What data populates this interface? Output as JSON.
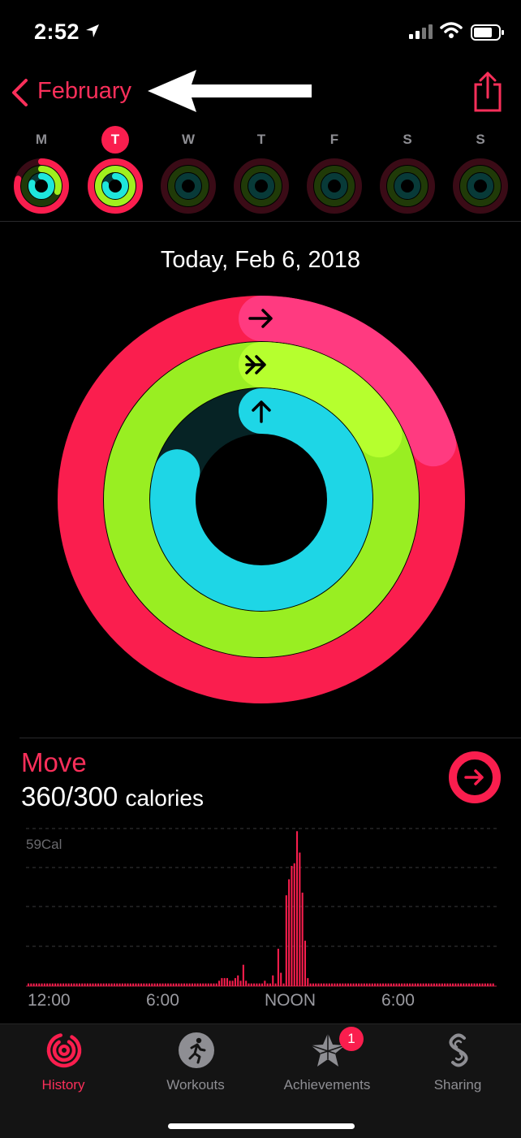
{
  "status_bar": {
    "time": "2:52"
  },
  "nav": {
    "back_label": "February"
  },
  "week": {
    "days": [
      "M",
      "T",
      "W",
      "T",
      "F",
      "S",
      "S"
    ],
    "today_index": 1
  },
  "summary": {
    "date": "Today, Feb 6, 2018"
  },
  "rings": {
    "move_progress": 1.2,
    "exercise_progress": 1.17,
    "stand_progress": 0.8
  },
  "move": {
    "title": "Move",
    "value": "360/300",
    "unit": "calories"
  },
  "chart_data": {
    "type": "bar",
    "y_label_max": "59Cal",
    "ylim": [
      0,
      59
    ],
    "x_ticks": [
      "12:00",
      "6:00",
      "NOON",
      "6:00"
    ],
    "values": [
      1,
      1,
      1,
      1,
      1,
      1,
      1,
      1,
      1,
      1,
      1,
      1,
      1,
      1,
      1,
      1,
      1,
      1,
      1,
      1,
      1,
      1,
      1,
      1,
      1,
      1,
      1,
      1,
      1,
      1,
      1,
      1,
      1,
      1,
      1,
      1,
      1,
      1,
      1,
      1,
      1,
      1,
      1,
      1,
      1,
      1,
      1,
      1,
      1,
      1,
      1,
      1,
      1,
      1,
      1,
      1,
      1,
      1,
      1,
      1,
      1,
      1,
      1,
      1,
      1,
      1,
      1,
      1,
      1,
      1,
      1,
      2,
      3,
      3,
      3,
      2,
      2,
      3,
      4,
      2,
      8,
      2,
      1,
      1,
      1,
      1,
      1,
      1,
      2,
      1,
      1,
      4,
      1,
      14,
      5,
      1,
      34,
      40,
      45,
      46,
      58,
      50,
      35,
      17,
      3,
      1,
      1,
      1,
      1,
      1,
      1,
      1,
      1,
      1,
      1,
      1,
      1,
      1,
      1,
      1,
      1,
      1,
      1,
      1,
      1,
      1,
      1,
      1,
      1,
      1,
      1,
      1,
      1,
      1,
      1,
      1,
      1,
      1,
      1,
      1,
      1,
      1,
      1,
      1,
      1,
      1,
      1,
      1,
      1,
      1,
      1,
      1,
      1,
      1,
      1,
      1,
      1,
      1,
      1,
      1,
      1,
      1,
      1,
      1,
      1,
      1,
      1,
      1,
      1,
      1,
      1,
      1,
      1,
      1
    ]
  },
  "tabs": [
    {
      "label": "History"
    },
    {
      "label": "Workouts"
    },
    {
      "label": "Achievements",
      "badge": "1"
    },
    {
      "label": "Sharing"
    }
  ],
  "colors": {
    "accent": "#fa2f5a",
    "move": "#fa1e4e",
    "exercise": "#a0f01e",
    "stand": "#1ee6dc"
  }
}
